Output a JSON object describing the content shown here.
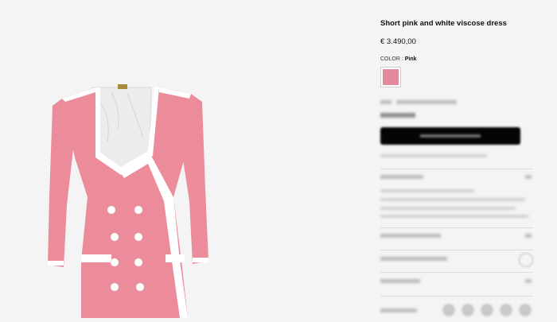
{
  "product": {
    "title": "Short pink and white viscose dress",
    "price": "€ 3.490,00",
    "color_label": "COLOR :",
    "color_value": "Pink"
  },
  "colors": {
    "dress_pink": "#ec8c9a",
    "trim_white": "#ffffff",
    "swatch_pink": "#e38a9c",
    "cta_black": "#050505"
  },
  "icons": [
    "chevron-down-icon",
    "plus-icon",
    "share-icon"
  ]
}
